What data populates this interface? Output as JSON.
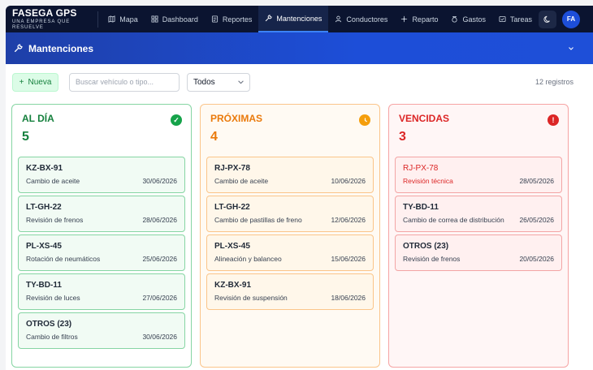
{
  "brand": {
    "name": "FASEGA GPS",
    "tagline": "UNA EMPRESA QUE RESUELVE"
  },
  "nav": [
    {
      "label": "Mapa",
      "icon": "map-icon"
    },
    {
      "label": "Dashboard",
      "icon": "grid-icon"
    },
    {
      "label": "Reportes",
      "icon": "report-icon"
    },
    {
      "label": "Mantenciones",
      "icon": "wrench-icon",
      "active": true
    },
    {
      "label": "Conductores",
      "icon": "user-icon"
    },
    {
      "label": "Reparto",
      "icon": "route-icon"
    },
    {
      "label": "Gastos",
      "icon": "money-icon"
    },
    {
      "label": "Tareas",
      "icon": "tasks-icon"
    }
  ],
  "user": {
    "initials": "FA"
  },
  "page": {
    "title": "Mantenciones"
  },
  "toolbar": {
    "new_label": "Nueva",
    "search_placeholder": "Buscar vehículo o tipo...",
    "filter_value": "Todos",
    "count_label": "12 registros"
  },
  "columns": [
    {
      "title": "AL DÍA",
      "count": "5",
      "status_icon": "check-circle-icon",
      "cards": [
        {
          "plate": "KZ-BX-91",
          "type": "Cambio de aceite",
          "date": "30/06/2026"
        },
        {
          "plate": "LT-GH-22",
          "type": "Revisión de frenos",
          "date": "28/06/2026"
        },
        {
          "plate": "PL-XS-45",
          "type": "Rotación de neumáticos",
          "date": "25/06/2026"
        },
        {
          "plate": "TY-BD-11",
          "type": "Revisión de luces",
          "date": "27/06/2026"
        },
        {
          "plate": "OTROS (23)",
          "type": "Cambio de filtros",
          "date": "30/06/2026"
        }
      ]
    },
    {
      "title": "PRÓXIMAS",
      "count": "4",
      "status_icon": "clock-icon",
      "cards": [
        {
          "plate": "RJ-PX-78",
          "type": "Cambio de aceite",
          "date": "10/06/2026"
        },
        {
          "plate": "LT-GH-22",
          "type": "Cambio de pastillas de freno",
          "date": "12/06/2026"
        },
        {
          "plate": "PL-XS-45",
          "type": "Alineación y balanceo",
          "date": "15/06/2026"
        },
        {
          "plate": "KZ-BX-91",
          "type": "Revisión de suspensión",
          "date": "18/06/2026"
        }
      ]
    },
    {
      "title": "VENCIDAS",
      "count": "3",
      "status_icon": "alert-circle-icon",
      "cards": [
        {
          "plate": "RJ-PX-78",
          "type": "Revisión técnica",
          "date": "28/05/2026"
        },
        {
          "plate": "TY-BD-11",
          "type": "Cambio de correa de distribución",
          "date": "26/05/2026"
        },
        {
          "plate": "OTROS (23)",
          "type": "Revisión de frenos",
          "date": "20/05/2026"
        }
      ]
    }
  ]
}
